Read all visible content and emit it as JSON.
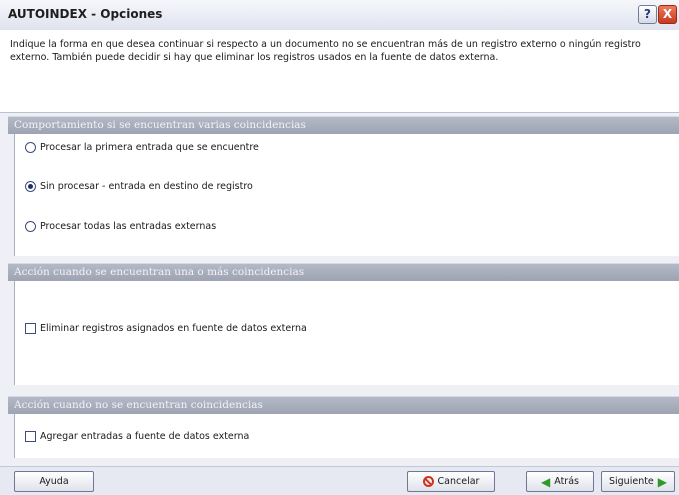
{
  "window": {
    "title": "AUTOINDEX - Opciones",
    "help_button": "?",
    "close_button": "X"
  },
  "intro": {
    "text": "Indique la forma en que desea continuar si respecto a un documento no se encuentran más de un registro externo o ningún registro externo. También puede decidir si hay que eliminar los registros usados en la fuente de datos externa."
  },
  "section_multiple": {
    "header": "Comportamiento si se encuentran varias coincidencias",
    "options": [
      {
        "label": "Procesar la primera entrada que se encuentre",
        "checked": false
      },
      {
        "label": "Sin procesar - entrada en destino de registro",
        "checked": true
      },
      {
        "label": "Procesar todas las entradas externas",
        "checked": false
      }
    ]
  },
  "section_found": {
    "header": "Acción cuando se encuentran una o más coincidencias",
    "checkbox_label": "Eliminar registros asignados en fuente de datos externa",
    "checked": false
  },
  "section_notfound": {
    "header": "Acción cuando no se encuentran coincidencias",
    "checkbox_label": "Agregar entradas a fuente de datos externa",
    "checked": false
  },
  "buttons": {
    "help": "Ayuda",
    "cancel": "Cancelar",
    "back": "Atrás",
    "next": "Siguiente"
  },
  "icons": {
    "cancel": "no-entry-icon",
    "back": "arrow-left-icon",
    "next": "arrow-right-icon"
  },
  "colors": {
    "section_header": "#a5aab9",
    "close_button": "#d9472a",
    "arrow_green": "#2f9a2a"
  }
}
